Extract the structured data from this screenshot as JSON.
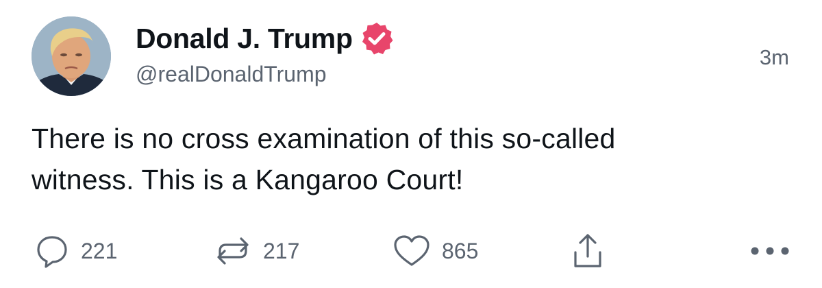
{
  "author": {
    "display_name": "Donald J. Trump",
    "handle": "@realDonaldTrump",
    "verified": true,
    "verified_color": "#e8456b"
  },
  "timestamp": "3m",
  "tweet": {
    "lines": [
      "There is no cross examination of this so-called",
      "witness. This is a Kangaroo Court!"
    ]
  },
  "actions": {
    "reply": {
      "icon": "reply-icon",
      "count": "221"
    },
    "retweet": {
      "icon": "retweet-icon",
      "count": "217"
    },
    "like": {
      "icon": "heart-icon",
      "count": "865"
    },
    "share": {
      "icon": "share-icon"
    },
    "more": {
      "icon": "more-icon"
    }
  },
  "colors": {
    "text_primary": "#0f1419",
    "text_secondary": "#5b6470",
    "background": "#ffffff"
  }
}
